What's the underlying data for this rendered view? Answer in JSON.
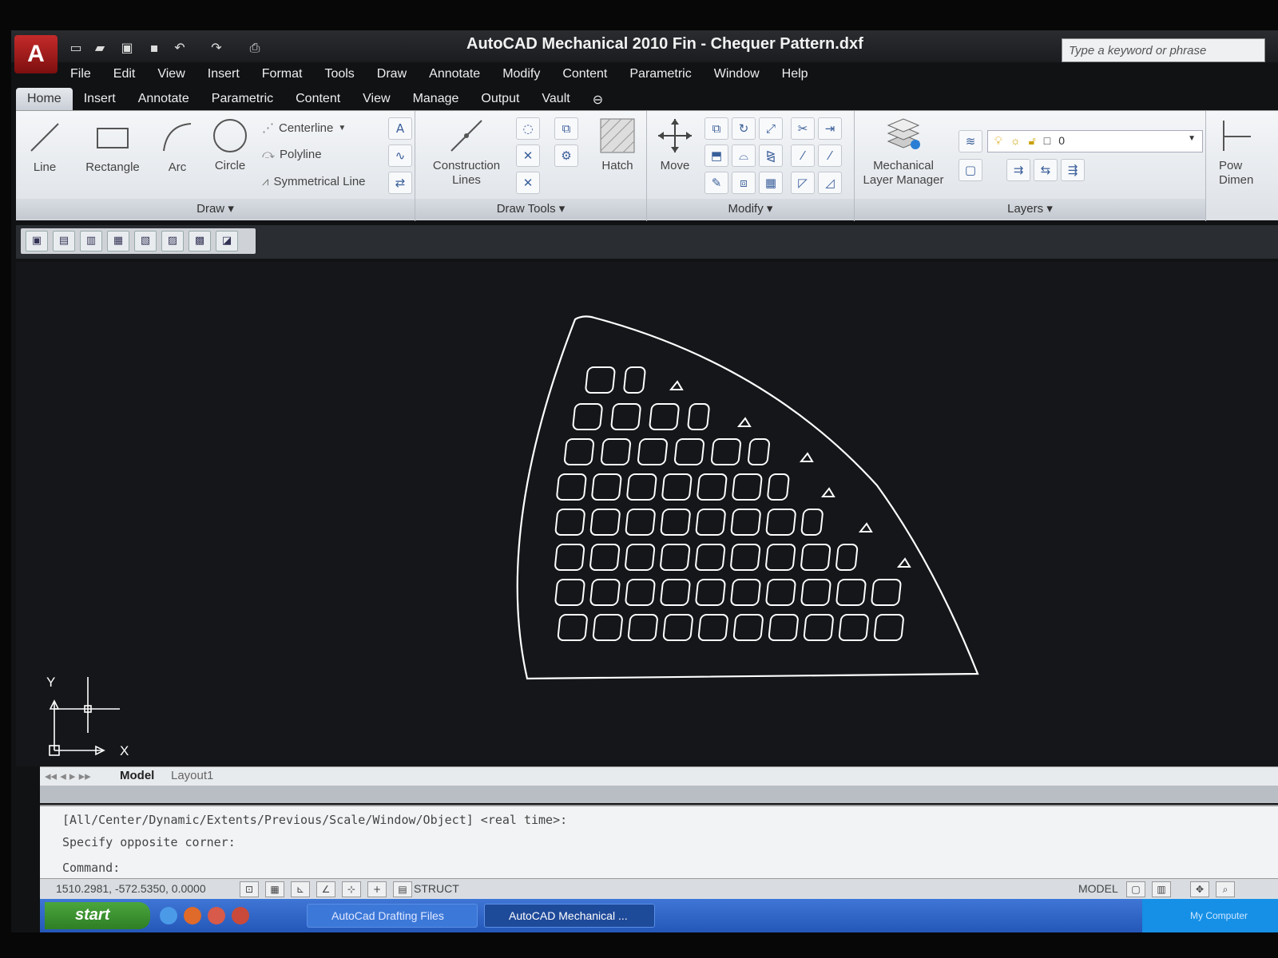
{
  "window": {
    "title": "AutoCAD Mechanical 2010    Fin - Chequer Pattern.dxf",
    "search_placeholder": "Type a keyword or phrase",
    "logo_letter": "A"
  },
  "menus": [
    "File",
    "Edit",
    "View",
    "Insert",
    "Format",
    "Tools",
    "Draw",
    "Annotate",
    "Modify",
    "Content",
    "Parametric",
    "Window",
    "Help"
  ],
  "ribbon_tabs": [
    "Home",
    "Insert",
    "Annotate",
    "Parametric",
    "Content",
    "View",
    "Manage",
    "Output",
    "Vault"
  ],
  "draw_panel": {
    "title": "Draw",
    "line": "Line",
    "rectangle": "Rectangle",
    "arc": "Arc",
    "circle": "Circle",
    "centerline": "Centerline",
    "polyline": "Polyline",
    "symmetrical_line": "Symmetrical Line"
  },
  "draw_tools_panel": {
    "title": "Draw Tools",
    "construction_lines": "Construction Lines",
    "hatch": "Hatch"
  },
  "modify_panel": {
    "title": "Modify",
    "move": "Move"
  },
  "layers_panel": {
    "title": "Layers",
    "layer_manager": "Mechanical Layer Manager",
    "current_layer": "0"
  },
  "dimension_panel": {
    "label": "Pow Dimen"
  },
  "layout_tabs": [
    "Model",
    "Layout1"
  ],
  "ucs": {
    "x_label": "X",
    "y_label": "Y"
  },
  "command": {
    "line1": "[All/Center/Dynamic/Extents/Previous/Scale/Window/Object] <real time>:",
    "line2": "Specify opposite corner:",
    "prompt": "Command:"
  },
  "status": {
    "coords": "1510.2981, -572.5350, 0.0000",
    "struct": "STRUCT",
    "model": "MODEL"
  },
  "taskbar": {
    "start": "start",
    "task1": "AutoCad Drafting Files",
    "task2": "AutoCAD Mechanical ...",
    "tray": "My Computer"
  },
  "colors": {
    "drawing_bg": "#141619",
    "geometry": "#ffffff",
    "taskbar": "#2457b8"
  }
}
